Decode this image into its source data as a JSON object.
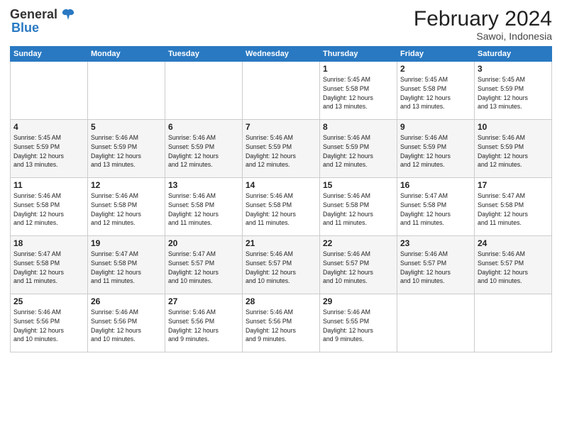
{
  "header": {
    "logo_general": "General",
    "logo_blue": "Blue",
    "month_year": "February 2024",
    "location": "Sawoi, Indonesia"
  },
  "weekdays": [
    "Sunday",
    "Monday",
    "Tuesday",
    "Wednesday",
    "Thursday",
    "Friday",
    "Saturday"
  ],
  "weeks": [
    [
      {
        "day": "",
        "info": ""
      },
      {
        "day": "",
        "info": ""
      },
      {
        "day": "",
        "info": ""
      },
      {
        "day": "",
        "info": ""
      },
      {
        "day": "1",
        "info": "Sunrise: 5:45 AM\nSunset: 5:58 PM\nDaylight: 12 hours\nand 13 minutes."
      },
      {
        "day": "2",
        "info": "Sunrise: 5:45 AM\nSunset: 5:58 PM\nDaylight: 12 hours\nand 13 minutes."
      },
      {
        "day": "3",
        "info": "Sunrise: 5:45 AM\nSunset: 5:59 PM\nDaylight: 12 hours\nand 13 minutes."
      }
    ],
    [
      {
        "day": "4",
        "info": "Sunrise: 5:45 AM\nSunset: 5:59 PM\nDaylight: 12 hours\nand 13 minutes."
      },
      {
        "day": "5",
        "info": "Sunrise: 5:46 AM\nSunset: 5:59 PM\nDaylight: 12 hours\nand 13 minutes."
      },
      {
        "day": "6",
        "info": "Sunrise: 5:46 AM\nSunset: 5:59 PM\nDaylight: 12 hours\nand 12 minutes."
      },
      {
        "day": "7",
        "info": "Sunrise: 5:46 AM\nSunset: 5:59 PM\nDaylight: 12 hours\nand 12 minutes."
      },
      {
        "day": "8",
        "info": "Sunrise: 5:46 AM\nSunset: 5:59 PM\nDaylight: 12 hours\nand 12 minutes."
      },
      {
        "day": "9",
        "info": "Sunrise: 5:46 AM\nSunset: 5:59 PM\nDaylight: 12 hours\nand 12 minutes."
      },
      {
        "day": "10",
        "info": "Sunrise: 5:46 AM\nSunset: 5:59 PM\nDaylight: 12 hours\nand 12 minutes."
      }
    ],
    [
      {
        "day": "11",
        "info": "Sunrise: 5:46 AM\nSunset: 5:58 PM\nDaylight: 12 hours\nand 12 minutes."
      },
      {
        "day": "12",
        "info": "Sunrise: 5:46 AM\nSunset: 5:58 PM\nDaylight: 12 hours\nand 12 minutes."
      },
      {
        "day": "13",
        "info": "Sunrise: 5:46 AM\nSunset: 5:58 PM\nDaylight: 12 hours\nand 11 minutes."
      },
      {
        "day": "14",
        "info": "Sunrise: 5:46 AM\nSunset: 5:58 PM\nDaylight: 12 hours\nand 11 minutes."
      },
      {
        "day": "15",
        "info": "Sunrise: 5:46 AM\nSunset: 5:58 PM\nDaylight: 12 hours\nand 11 minutes."
      },
      {
        "day": "16",
        "info": "Sunrise: 5:47 AM\nSunset: 5:58 PM\nDaylight: 12 hours\nand 11 minutes."
      },
      {
        "day": "17",
        "info": "Sunrise: 5:47 AM\nSunset: 5:58 PM\nDaylight: 12 hours\nand 11 minutes."
      }
    ],
    [
      {
        "day": "18",
        "info": "Sunrise: 5:47 AM\nSunset: 5:58 PM\nDaylight: 12 hours\nand 11 minutes."
      },
      {
        "day": "19",
        "info": "Sunrise: 5:47 AM\nSunset: 5:58 PM\nDaylight: 12 hours\nand 11 minutes."
      },
      {
        "day": "20",
        "info": "Sunrise: 5:47 AM\nSunset: 5:57 PM\nDaylight: 12 hours\nand 10 minutes."
      },
      {
        "day": "21",
        "info": "Sunrise: 5:46 AM\nSunset: 5:57 PM\nDaylight: 12 hours\nand 10 minutes."
      },
      {
        "day": "22",
        "info": "Sunrise: 5:46 AM\nSunset: 5:57 PM\nDaylight: 12 hours\nand 10 minutes."
      },
      {
        "day": "23",
        "info": "Sunrise: 5:46 AM\nSunset: 5:57 PM\nDaylight: 12 hours\nand 10 minutes."
      },
      {
        "day": "24",
        "info": "Sunrise: 5:46 AM\nSunset: 5:57 PM\nDaylight: 12 hours\nand 10 minutes."
      }
    ],
    [
      {
        "day": "25",
        "info": "Sunrise: 5:46 AM\nSunset: 5:56 PM\nDaylight: 12 hours\nand 10 minutes."
      },
      {
        "day": "26",
        "info": "Sunrise: 5:46 AM\nSunset: 5:56 PM\nDaylight: 12 hours\nand 10 minutes."
      },
      {
        "day": "27",
        "info": "Sunrise: 5:46 AM\nSunset: 5:56 PM\nDaylight: 12 hours\nand 9 minutes."
      },
      {
        "day": "28",
        "info": "Sunrise: 5:46 AM\nSunset: 5:56 PM\nDaylight: 12 hours\nand 9 minutes."
      },
      {
        "day": "29",
        "info": "Sunrise: 5:46 AM\nSunset: 5:55 PM\nDaylight: 12 hours\nand 9 minutes."
      },
      {
        "day": "",
        "info": ""
      },
      {
        "day": "",
        "info": ""
      }
    ]
  ]
}
